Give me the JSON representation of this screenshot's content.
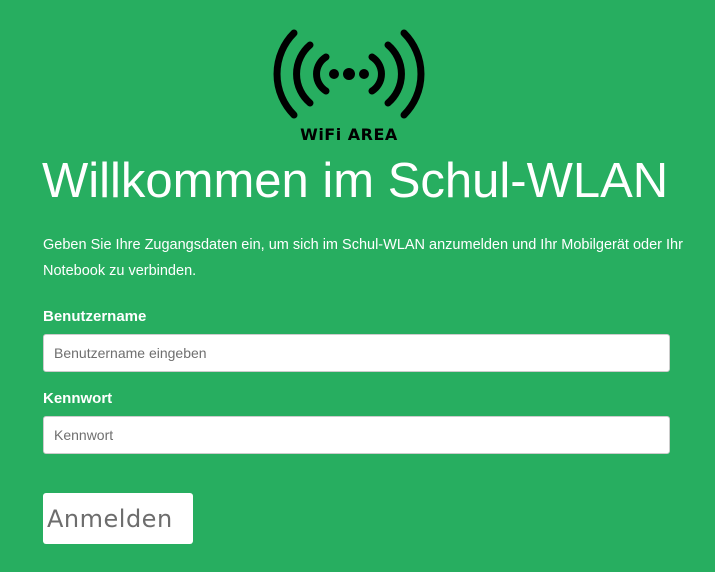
{
  "logo": {
    "icon": "wifi-signal-icon",
    "text": "WiFi AREA"
  },
  "page": {
    "title": "Willkommen im Schul-WLAN",
    "intro": "Geben Sie Ihre Zugangsdaten ein, um sich im Schul-WLAN anzumelden und Ihr Mobilgerät oder Ihr Notebook zu verbinden."
  },
  "form": {
    "username_label": "Benutzername",
    "username_placeholder": "Benutzername eingeben",
    "username_value": "",
    "password_label": "Kennwort",
    "password_placeholder": "Kennwort",
    "password_value": "",
    "submit_label": "Anmelden"
  },
  "colors": {
    "background": "#27ae60",
    "text": "#ffffff",
    "logo": "#000000",
    "button_text": "#6d6d6d"
  }
}
